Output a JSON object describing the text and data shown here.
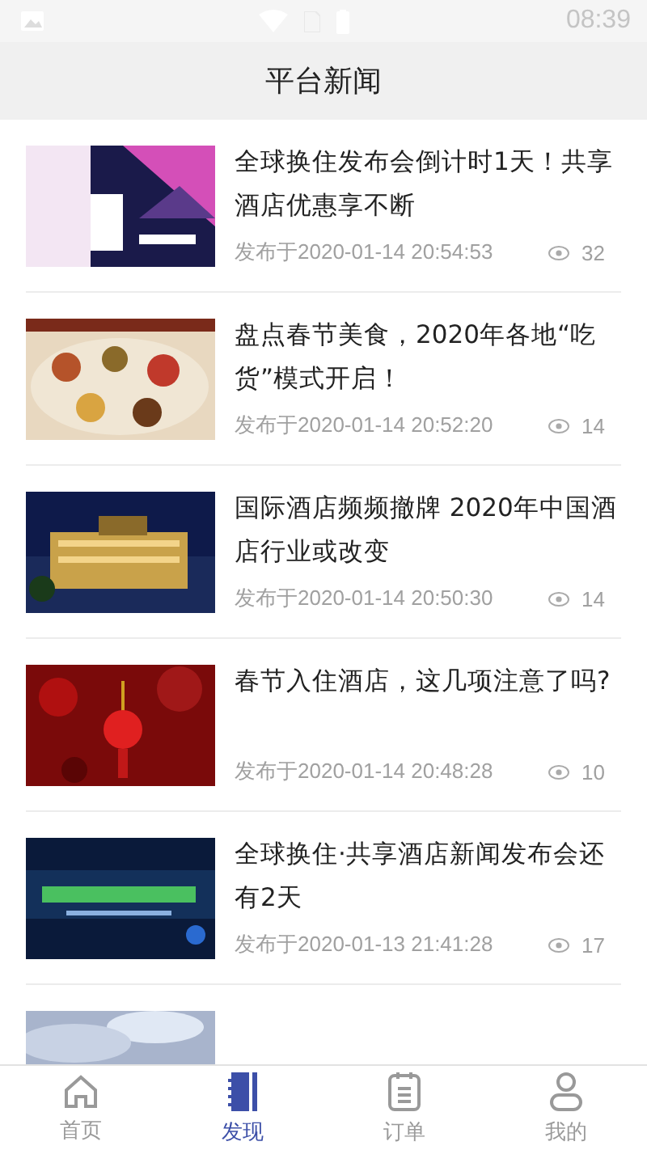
{
  "status_bar": {
    "time": "08:39"
  },
  "header": {
    "title": "平台新闻"
  },
  "news": [
    {
      "kind": "article",
      "title": "全球换住发布会倒计时1天！共享酒店优惠享不断",
      "date": "发布于2020-01-14 20:54:53",
      "views": "32"
    },
    {
      "kind": "article",
      "title": "盘点春节美食，2020年各地“吃货”模式开启！",
      "date": "发布于2020-01-14 20:52:20",
      "views": "14"
    },
    {
      "kind": "article",
      "title": "国际酒店频频撤牌 2020年中国酒店行业或改变",
      "date": "发布于2020-01-14 20:50:30",
      "views": "14"
    },
    {
      "kind": "article",
      "title": "春节入住酒店，这几项注意了吗?",
      "date": "发布于2020-01-14 20:48:28",
      "views": "10"
    },
    {
      "kind": "article",
      "title": "全球换住·共享酒店新闻发布会还有2天",
      "date": "发布于2020-01-13 21:41:28",
      "views": "17"
    },
    {
      "kind": "picture"
    }
  ],
  "tabs": [
    {
      "label": "首页",
      "selected": false
    },
    {
      "label": "发现",
      "selected": true
    },
    {
      "label": "订单",
      "selected": false
    },
    {
      "label": "我的",
      "selected": false
    }
  ]
}
